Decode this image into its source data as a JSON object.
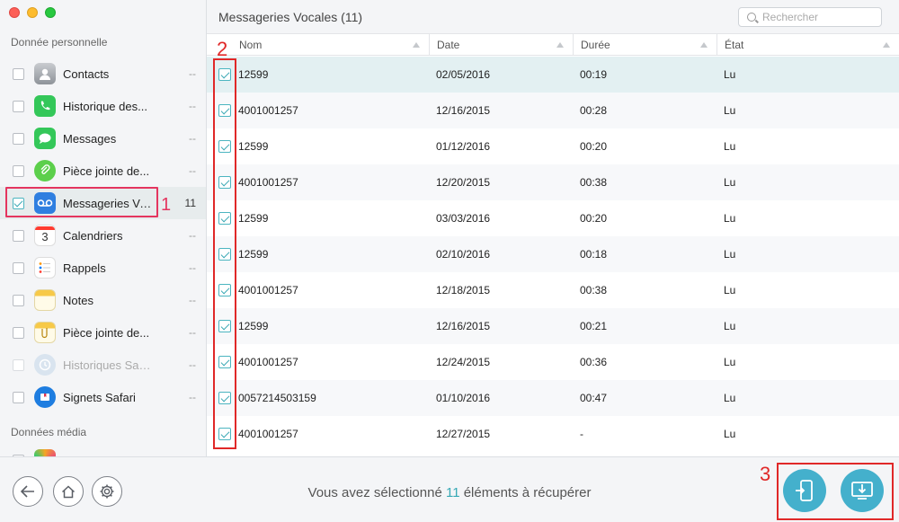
{
  "window": {
    "title": "Messageries Vocales (11)",
    "search_placeholder": "Rechercher"
  },
  "sidebar": {
    "section_personal": "Donnée personnelle",
    "section_media": "Données média",
    "items": [
      {
        "label": "Contacts",
        "count": "--",
        "icon": "contacts-icon",
        "color": "#9aa0a6"
      },
      {
        "label": "Historique des...",
        "count": "--",
        "icon": "phone-icon",
        "color": "#34c759"
      },
      {
        "label": "Messages",
        "count": "--",
        "icon": "messages-icon",
        "color": "#34c759"
      },
      {
        "label": "Pièce jointe de...",
        "count": "--",
        "icon": "attachment-icon",
        "color": "#5ccf4b"
      },
      {
        "label": "Messageries Vo...",
        "count": "11",
        "icon": "voicemail-icon",
        "color": "#2f7fe0"
      },
      {
        "label": "Calendriers",
        "count": "--",
        "icon": "calendar-icon",
        "color": "#ffffff"
      },
      {
        "label": "Rappels",
        "count": "--",
        "icon": "reminders-icon",
        "color": "#ffffff"
      },
      {
        "label": "Notes",
        "count": "--",
        "icon": "notes-icon",
        "color": "#f7c948"
      },
      {
        "label": "Pièce jointe de...",
        "count": "--",
        "icon": "notes-attachment-icon",
        "color": "#f7c948"
      },
      {
        "label": "Historiques Safari",
        "count": "--",
        "icon": "safari-history-icon",
        "color": "#b9c9dc"
      },
      {
        "label": "Signets Safari",
        "count": "--",
        "icon": "safari-bookmarks-icon",
        "color": "#1e7de0"
      }
    ],
    "calendar_day": "3"
  },
  "annotations": {
    "mark1": "1",
    "mark2": "2",
    "mark3": "3"
  },
  "table": {
    "columns": [
      "Nom",
      "Date",
      "Durée",
      "État"
    ],
    "rows": [
      {
        "nom": "12599",
        "date": "02/05/2016",
        "duree": "00:19",
        "etat": "Lu"
      },
      {
        "nom": "4001001257",
        "date": "12/16/2015",
        "duree": "00:28",
        "etat": "Lu"
      },
      {
        "nom": "12599",
        "date": "01/12/2016",
        "duree": "00:20",
        "etat": "Lu"
      },
      {
        "nom": "4001001257",
        "date": "12/20/2015",
        "duree": "00:38",
        "etat": "Lu"
      },
      {
        "nom": "12599",
        "date": "03/03/2016",
        "duree": "00:20",
        "etat": "Lu"
      },
      {
        "nom": "12599",
        "date": "02/10/2016",
        "duree": "00:18",
        "etat": "Lu"
      },
      {
        "nom": "4001001257",
        "date": "12/18/2015",
        "duree": "00:38",
        "etat": "Lu"
      },
      {
        "nom": "12599",
        "date": "12/16/2015",
        "duree": "00:21",
        "etat": "Lu"
      },
      {
        "nom": "4001001257",
        "date": "12/24/2015",
        "duree": "00:36",
        "etat": "Lu"
      },
      {
        "nom": "0057214503159",
        "date": "01/10/2016",
        "duree": "00:47",
        "etat": "Lu"
      },
      {
        "nom": "4001001257",
        "date": "12/27/2015",
        "duree": "-",
        "etat": "Lu"
      }
    ]
  },
  "footer": {
    "status_prefix": "Vous avez sélectionné",
    "status_count": "11",
    "status_suffix": "éléments à récupérer"
  },
  "colors": {
    "accent": "#36a9b5",
    "annotation_red": "#e02828",
    "annotation_pink": "#e4355f",
    "action_button": "#44b0cc"
  }
}
